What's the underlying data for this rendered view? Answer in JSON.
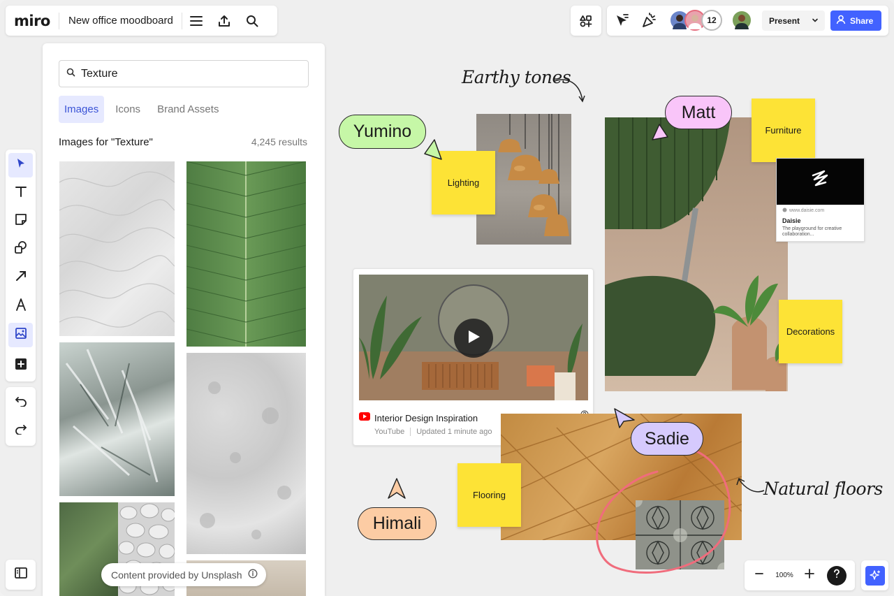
{
  "header": {
    "logo": "miro",
    "board_title": "New office moodboard",
    "avatar_count": "12",
    "present_label": "Present",
    "share_label": "Share",
    "accent": "#4262ff"
  },
  "search_panel": {
    "query": "Texture",
    "tabs": [
      {
        "label": "Images",
        "active": true
      },
      {
        "label": "Icons",
        "active": false
      },
      {
        "label": "Brand Assets",
        "active": false
      }
    ],
    "results_title": "Images for \"Texture\"",
    "results_count": "4,245 results",
    "credit": "Content provided by Unsplash"
  },
  "toolbar": {
    "tools": [
      "select-icon",
      "text-icon",
      "sticky-note-icon",
      "shapes-icon",
      "arrow-icon",
      "pen-icon",
      "image-icon",
      "add-icon"
    ],
    "undo": "undo-icon",
    "redo": "redo-icon"
  },
  "board": {
    "labels": {
      "earthy": "Earthy tones",
      "natural": "Natural floors"
    },
    "stickies": {
      "lighting": "Lighting",
      "furniture": "Furniture",
      "decorations": "Decorations",
      "flooring": "Flooring"
    },
    "cursors": {
      "yumino": "Yumino",
      "matt": "Matt",
      "sadie": "Sadie",
      "himali": "Himali"
    },
    "video_card": {
      "title": "Interior Design Inspiration",
      "source": "YouTube",
      "updated": "Updated 1 minute ago"
    },
    "daisie_card": {
      "url": "www.daisie.com",
      "title": "Daisie",
      "desc": "The playground for creative collaboration..."
    }
  },
  "zoom": {
    "level": "100%"
  }
}
